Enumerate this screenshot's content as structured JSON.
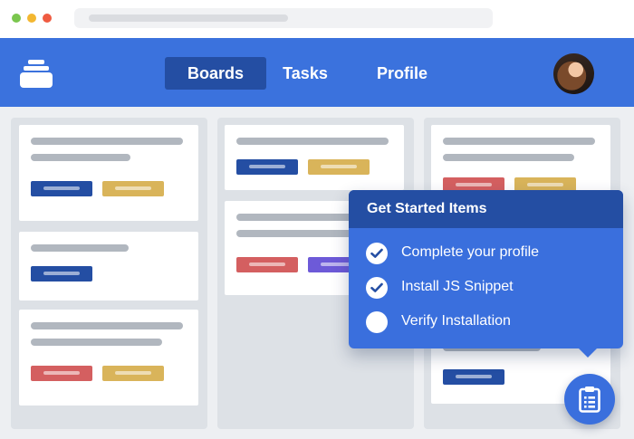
{
  "nav": {
    "tabs": [
      {
        "label": "Boards",
        "active": true
      },
      {
        "label": "Tasks",
        "active": false
      },
      {
        "label": "Profile",
        "active": false
      }
    ]
  },
  "icons": {
    "logo": "stacked-boards-logo",
    "avatar": "user-avatar",
    "fab": "clipboard-checklist-icon",
    "checked": "checkmark-circle-icon",
    "unchecked": "empty-circle-icon"
  },
  "colors": {
    "primary": "#3b72dd",
    "primary_dark": "#244ea3",
    "chip_gold": "#d9b45a",
    "chip_red": "#d45f60",
    "chip_purple": "#6d5ad8"
  },
  "get_started": {
    "title": "Get Started Items",
    "items": [
      {
        "label": "Complete your profile",
        "done": true
      },
      {
        "label": "Install JS Snippet",
        "done": true
      },
      {
        "label": "Verify Installation",
        "done": false
      }
    ]
  }
}
